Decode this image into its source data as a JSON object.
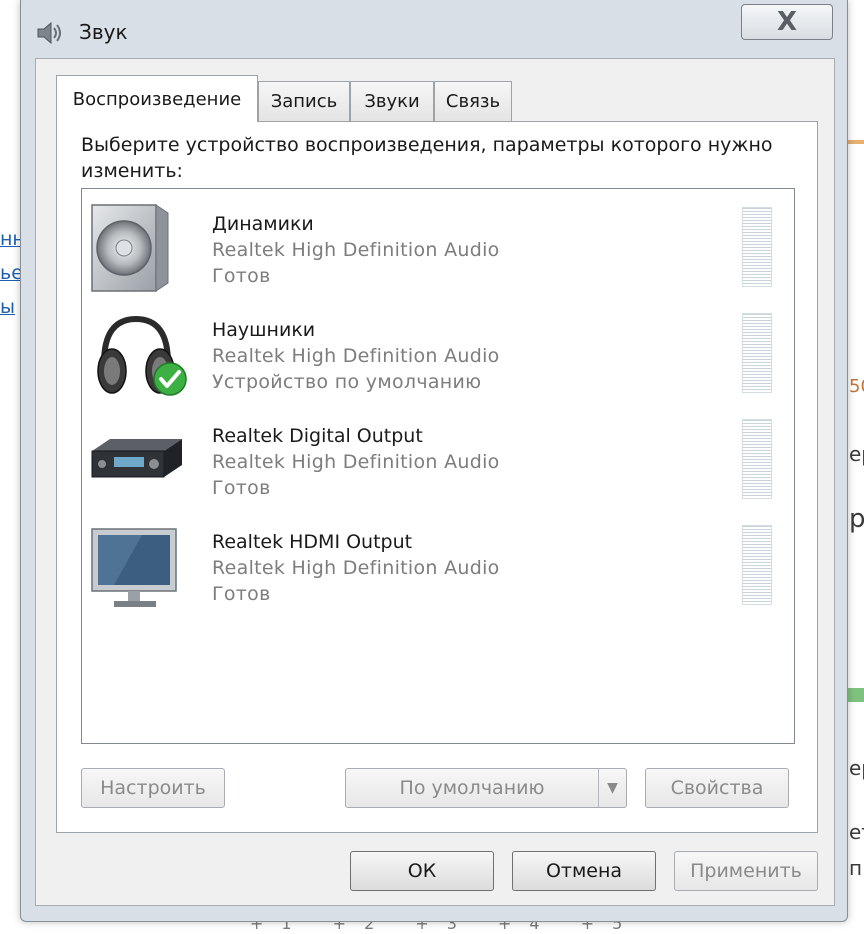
{
  "background": {
    "fragments": [
      "нн",
      "ье",
      "ы",
      "50",
      "ер",
      "р",
      "ер",
      "ет",
      "п"
    ],
    "taskbar_strip": "+1 +2 +3 +4 +5"
  },
  "window": {
    "title": "Звук",
    "close_label": "X"
  },
  "tabs": [
    {
      "label": "Воспроизведение",
      "active": true
    },
    {
      "label": "Запись",
      "active": false
    },
    {
      "label": "Звуки",
      "active": false
    },
    {
      "label": "Связь",
      "active": false
    }
  ],
  "instruction": "Выберите устройство воспроизведения, параметры которого нужно изменить:",
  "devices": [
    {
      "name": "Динамики",
      "driver": "Realtek High Definition Audio",
      "status": "Готов",
      "icon": "speaker-icon"
    },
    {
      "name": "Наушники",
      "driver": "Realtek High Definition Audio",
      "status": "Устройство по умолчанию",
      "icon": "headphones-icon",
      "default": true
    },
    {
      "name": "Realtek Digital Output",
      "driver": "Realtek High Definition Audio",
      "status": "Готов",
      "icon": "receiver-icon"
    },
    {
      "name": "Realtek HDMI Output",
      "driver": "Realtek High Definition Audio",
      "status": "Готов",
      "icon": "monitor-icon"
    }
  ],
  "buttons": {
    "configure": "Настроить",
    "set_default": "По умолчанию",
    "properties": "Свойства",
    "ok": "ОК",
    "cancel": "Отмена",
    "apply": "Применить"
  },
  "colors": {
    "window_frame": "#d9dfe6",
    "panel_bg": "#ffffff",
    "default_check": "#3cb043",
    "link_blue": "#1f5fb0"
  }
}
